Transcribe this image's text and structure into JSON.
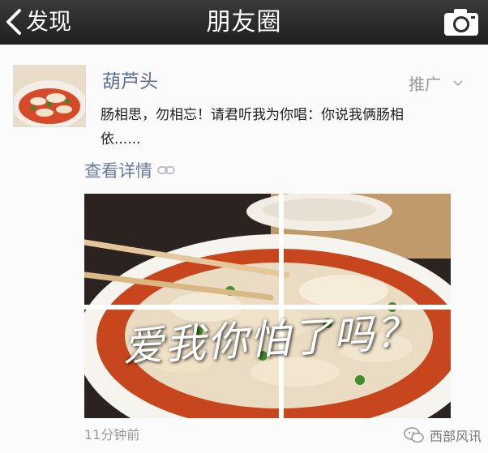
{
  "nav": {
    "back_label": "发现",
    "title": "朋友圈",
    "back_icon": "chevron-left-icon",
    "camera_icon": "camera-icon"
  },
  "post": {
    "username": "葫芦头",
    "promo_label": "推广",
    "text": "肠相思，勿相忘！请君听我为你唱：你说我俩肠相依......",
    "details_label": "查看详情",
    "image_overlay_text": "爱我你怕了吗？",
    "time": "11分钟前"
  },
  "watermark": {
    "text": "西部风讯",
    "icon": "wechat-icon"
  },
  "colors": {
    "nav_background": "#2a2a2a",
    "username": "#5d6f98",
    "link": "#6a7aa0",
    "muted": "#9a9a9a"
  }
}
